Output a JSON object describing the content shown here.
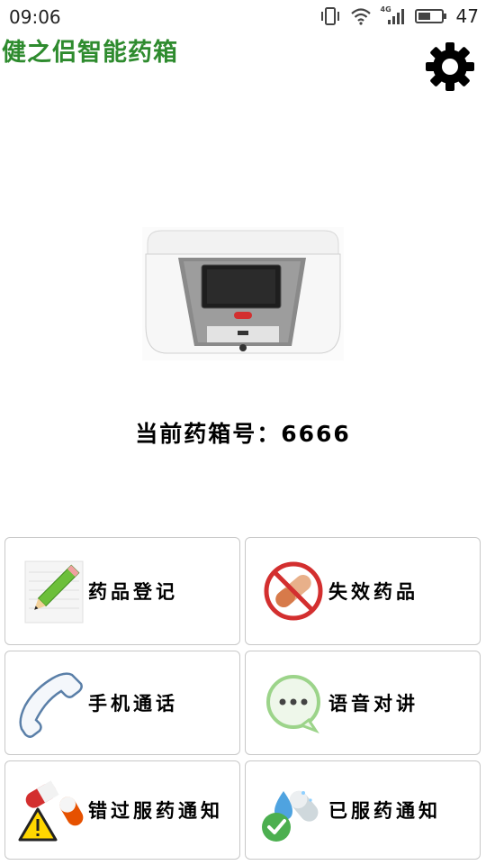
{
  "status_bar": {
    "time": "09:06",
    "network": "4G",
    "battery": "47"
  },
  "app": {
    "title": "健之侣智能药箱"
  },
  "settings": {
    "icon": "gear-icon"
  },
  "device": {
    "box_label": "当前药箱号：6666"
  },
  "menu": [
    {
      "label": "药品登记",
      "icon": "pencil-notepad-icon"
    },
    {
      "label": "失效药品",
      "icon": "no-capsule-icon"
    },
    {
      "label": "手机通话",
      "icon": "phone-handset-icon"
    },
    {
      "label": "语音对讲",
      "icon": "chat-bubble-icon"
    },
    {
      "label": "错过服药通知",
      "icon": "warning-pills-icon"
    },
    {
      "label": "已服药通知",
      "icon": "check-pills-icon"
    }
  ],
  "colors": {
    "title_green": "#2e8b2e",
    "tile_border": "#c8c8c8"
  }
}
